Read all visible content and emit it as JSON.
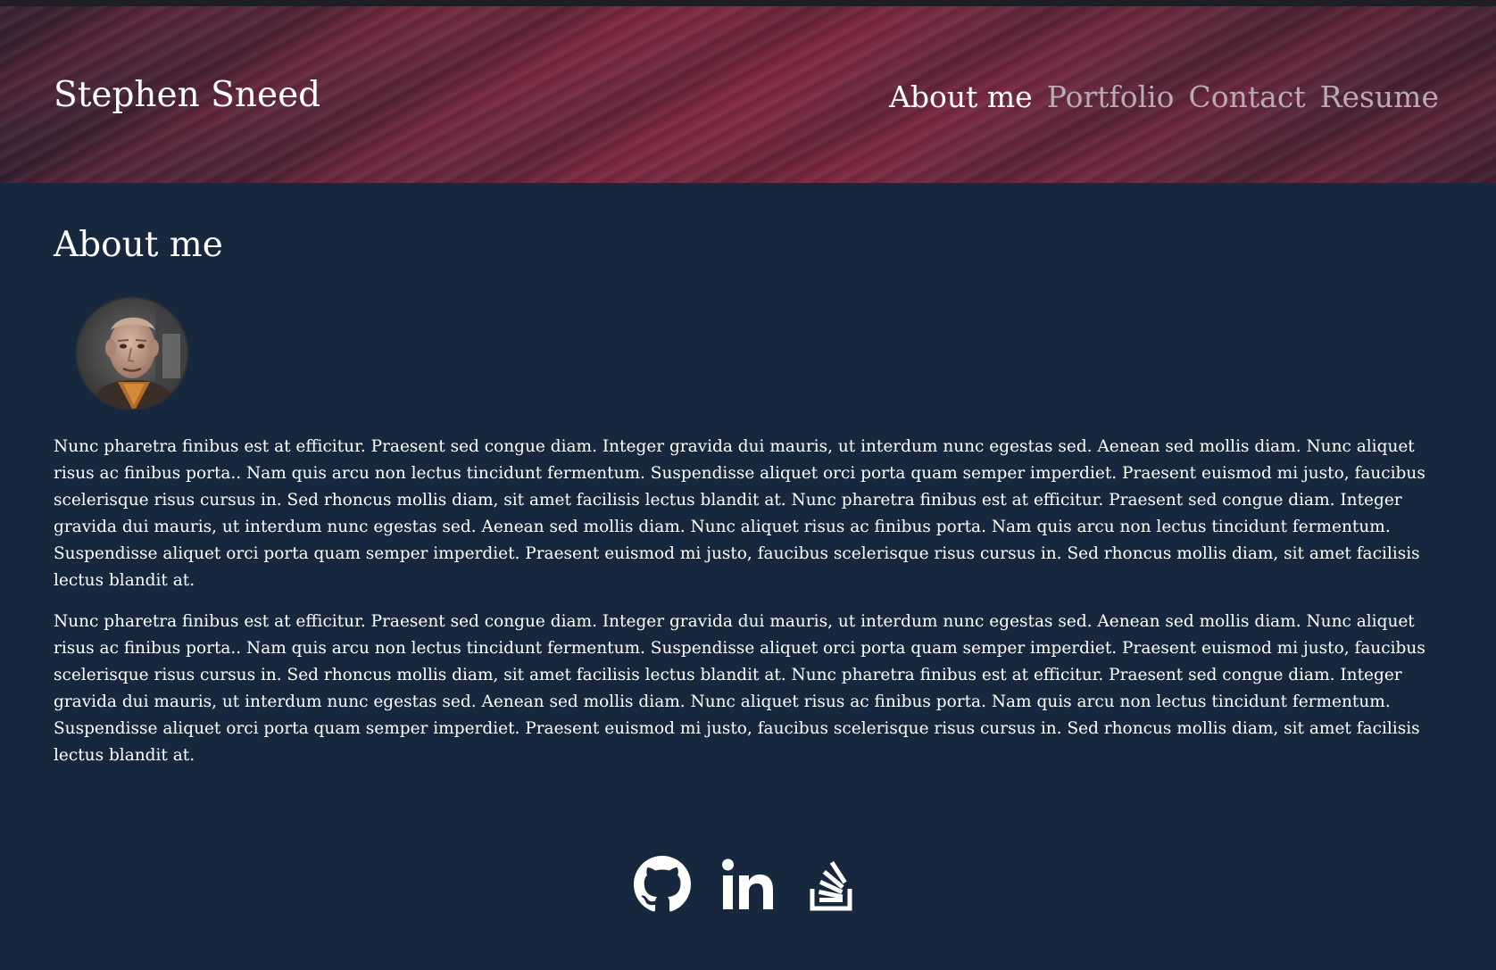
{
  "header": {
    "site_title": "Stephen Sneed",
    "nav": [
      {
        "label": "About me",
        "active": true
      },
      {
        "label": "Portfolio",
        "active": false
      },
      {
        "label": "Contact",
        "active": false
      },
      {
        "label": "Resume",
        "active": false
      }
    ]
  },
  "main": {
    "heading": "About me",
    "paragraphs": [
      "Nunc pharetra finibus est at efficitur. Praesent sed congue diam. Integer gravida dui mauris, ut interdum nunc egestas sed. Aenean sed mollis diam. Nunc aliquet risus ac finibus porta.. Nam quis arcu non lectus tincidunt fermentum. Suspendisse aliquet orci porta quam semper imperdiet. Praesent euismod mi justo, faucibus scelerisque risus cursus in. Sed rhoncus mollis diam, sit amet facilisis lectus blandit at. Nunc pharetra finibus est at efficitur. Praesent sed congue diam. Integer gravida dui mauris, ut interdum nunc egestas sed. Aenean sed mollis diam. Nunc aliquet risus ac finibus porta. Nam quis arcu non lectus tincidunt fermentum. Suspendisse aliquet orci porta quam semper imperdiet. Praesent euismod mi justo, faucibus scelerisque risus cursus in. Sed rhoncus mollis diam, sit amet facilisis lectus blandit at.",
      "Nunc pharetra finibus est at efficitur. Praesent sed congue diam. Integer gravida dui mauris, ut interdum nunc egestas sed. Aenean sed mollis diam. Nunc aliquet risus ac finibus porta.. Nam quis arcu non lectus tincidunt fermentum. Suspendisse aliquet orci porta quam semper imperdiet. Praesent euismod mi justo, faucibus scelerisque risus cursus in. Sed rhoncus mollis diam, sit amet facilisis lectus blandit at. Nunc pharetra finibus est at efficitur. Praesent sed congue diam. Integer gravida dui mauris, ut interdum nunc egestas sed. Aenean sed mollis diam. Nunc aliquet risus ac finibus porta. Nam quis arcu non lectus tincidunt fermentum. Suspendisse aliquet orci porta quam semper imperdiet. Praesent euismod mi justo, faucibus scelerisque risus cursus in. Sed rhoncus mollis diam, sit amet facilisis lectus blandit at."
    ]
  },
  "social": {
    "icons": [
      "github-icon",
      "linkedin-icon",
      "stackoverflow-icon"
    ]
  },
  "colors": {
    "background": "#17273d",
    "header_accent": "#7c2a41",
    "nav_inactive": "#b9aab6",
    "text": "#ffffff"
  }
}
